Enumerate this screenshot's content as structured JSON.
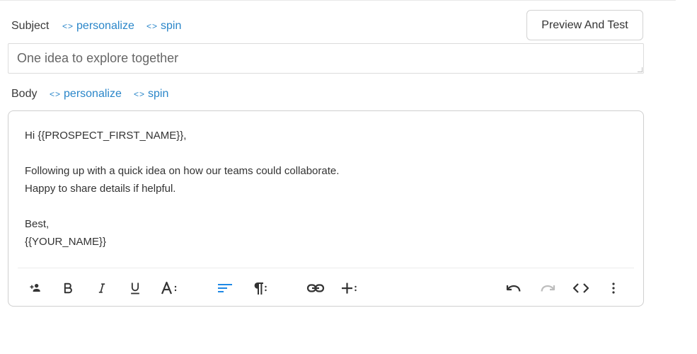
{
  "subject": {
    "label": "Subject",
    "personalize": "personalize",
    "spin": "spin",
    "value": "One idea to explore together"
  },
  "body": {
    "label": "Body",
    "personalize": "personalize",
    "spin": "spin",
    "lines": [
      "Hi {{PROSPECT_FIRST_NAME}},",
      "",
      "Following up with a quick idea on how our teams could collaborate.",
      "Happy to share details if helpful.",
      "",
      "Best,",
      "{{YOUR_NAME}}"
    ]
  },
  "tag_glyph": "<>",
  "preview_button": "Preview And Test",
  "toolbar": {
    "icons": [
      "add-person-icon",
      "bold-icon",
      "italic-icon",
      "underline-icon",
      "font-size-icon",
      "align-left-icon",
      "paragraph-icon",
      "link-icon",
      "insert-icon",
      "undo-icon",
      "redo-icon",
      "code-view-icon",
      "more-options-icon"
    ],
    "active_color": "#1e88e5",
    "icon_color": "#333333",
    "disabled_color": "#bdbdbd"
  },
  "colors": {
    "link": "#2a86c9",
    "border": "#cfcfcf"
  }
}
